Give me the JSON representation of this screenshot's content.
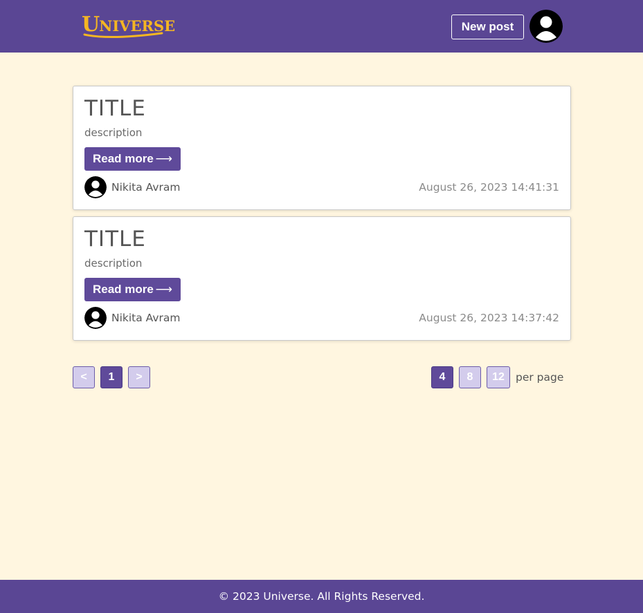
{
  "header": {
    "logo_text": "Universe",
    "logo_first": "U",
    "logo_rest": "NIVERSE",
    "new_post_label": "New post",
    "avatar_icon": "user-avatar-icon"
  },
  "posts": [
    {
      "title": "TITLE",
      "description": "description",
      "read_more_label": "Read more",
      "read_more_arrow": "⟶",
      "author": "Nikita Avram",
      "date": "August 26, 2023 14:41:31"
    },
    {
      "title": "TITLE",
      "description": "description",
      "read_more_label": "Read more",
      "read_more_arrow": "⟶",
      "author": "Nikita Avram",
      "date": "August 26, 2023 14:37:42"
    }
  ],
  "pagination": {
    "prev": "<",
    "current": "1",
    "next": ">",
    "per_page_options": [
      "4",
      "8",
      "12"
    ],
    "per_page_selected": "4",
    "per_page_label": "per page"
  },
  "footer": {
    "text": "© 2023 Universe. All Rights Reserved."
  },
  "colors": {
    "brand_purple": "#5a4694",
    "button_purple": "#5f4a9a",
    "logo_yellow": "#f5b622",
    "page_background": "#fff6e0",
    "light_button": "#d3ccec"
  }
}
